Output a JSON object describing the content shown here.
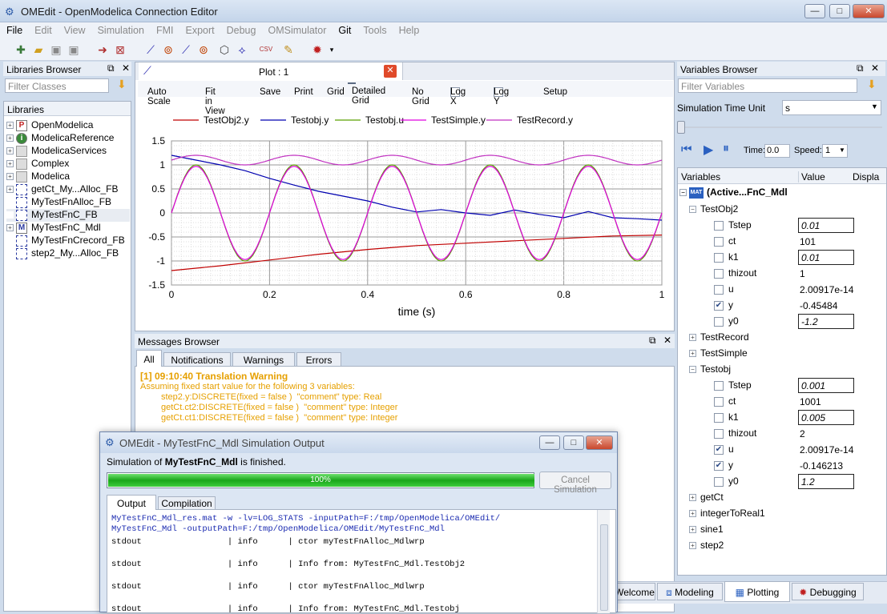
{
  "window": {
    "title": "OMEdit - OpenModelica Connection Editor",
    "min_label": "—",
    "max_label": "□",
    "close_label": "✕"
  },
  "menu": [
    {
      "label": "File",
      "on": true
    },
    {
      "label": "Edit"
    },
    {
      "label": "View"
    },
    {
      "label": "Simulation"
    },
    {
      "label": "FMI"
    },
    {
      "label": "Export"
    },
    {
      "label": "Debug"
    },
    {
      "label": "OMSimulator"
    },
    {
      "label": "Git",
      "on": true
    },
    {
      "label": "Tools"
    },
    {
      "label": "Help"
    }
  ],
  "libraries_browser": {
    "title": "Libraries Browser",
    "filter_placeholder": "Filter Classes",
    "header": "Libraries",
    "items": [
      {
        "label": "OpenModelica",
        "icon": "P"
      },
      {
        "label": "ModelicaReference",
        "icon": "i"
      },
      {
        "label": "ModelicaServices",
        "icon": ""
      },
      {
        "label": "Complex",
        "icon": ""
      },
      {
        "label": "Modelica",
        "icon": ""
      },
      {
        "label": "getCt_My...Alloc_FB",
        "icon": ""
      },
      {
        "label": "MyTestFnAlloc_FB",
        "icon": ""
      },
      {
        "label": "MyTestFnC_FB",
        "icon": ""
      },
      {
        "label": "MyTestFnC_Mdl",
        "icon": "M"
      },
      {
        "label": "MyTestFnCrecord_FB",
        "icon": ""
      },
      {
        "label": "step2_My...Alloc_FB",
        "icon": ""
      }
    ]
  },
  "plot": {
    "tab_title": "Plot : 1",
    "tools": [
      "Auto Scale",
      "Fit in View",
      "Save",
      "Print",
      "Grid",
      "Detailed Grid",
      "No Grid",
      "Log X",
      "Log Y",
      "Setup"
    ]
  },
  "chart_data": {
    "type": "line",
    "xlabel": "time (s)",
    "ylabel": "",
    "xlim": [
      0,
      1
    ],
    "ylim": [
      -1.5,
      1.5
    ],
    "xticks": [
      "0",
      "0.2",
      "0.4",
      "0.6",
      "0.8",
      "1"
    ],
    "yticks": [
      "1.5",
      "1",
      "0.5",
      "0",
      "-0.5",
      "-1",
      "-1.5"
    ],
    "grid": "detailed",
    "legend": "top",
    "series": [
      {
        "name": "TestObj2.y",
        "color": "#c00000",
        "x": [
          0,
          0.1,
          0.2,
          0.3,
          0.4,
          0.5,
          0.6,
          0.7,
          0.8,
          0.9,
          1.0
        ],
        "y": [
          -1.2,
          -1.1,
          -0.98,
          -0.86,
          -0.76,
          -0.68,
          -0.63,
          -0.58,
          -0.53,
          -0.48,
          -0.46
        ]
      },
      {
        "name": "Testobj.y",
        "color": "#0000b0",
        "x": [
          0,
          0.05,
          0.1,
          0.15,
          0.2,
          0.25,
          0.3,
          0.35,
          0.4,
          0.45,
          0.5,
          0.55,
          0.6,
          0.65,
          0.7,
          0.75,
          0.8,
          0.85,
          0.9,
          0.95,
          1.0
        ],
        "y": [
          1.2,
          1.1,
          1.0,
          0.88,
          0.72,
          0.58,
          0.45,
          0.35,
          0.25,
          0.12,
          0.02,
          0.07,
          0.0,
          -0.05,
          0.06,
          -0.03,
          -0.1,
          0.03,
          -0.1,
          -0.12,
          -0.15
        ]
      },
      {
        "name": "Testobj.u",
        "color": "#5aa000",
        "x": [
          0,
          0.05,
          0.1,
          0.15,
          0.2,
          0.25,
          0.3,
          0.35,
          0.4,
          0.45,
          0.5,
          0.55,
          0.6,
          0.65,
          0.7,
          0.75,
          0.8,
          0.85,
          0.9,
          0.95,
          1.0
        ],
        "y": [
          0,
          1,
          0,
          -1,
          0,
          1,
          0,
          -1,
          0,
          1,
          0,
          -1,
          0,
          1,
          0,
          -1,
          0,
          1,
          0,
          -1,
          0
        ]
      },
      {
        "name": "TestSimple.y",
        "color": "#e000e0",
        "x": [
          0,
          0.05,
          0.1,
          0.15,
          0.2,
          0.25,
          0.3,
          0.35,
          0.4,
          0.45,
          0.5,
          0.55,
          0.6,
          0.65,
          0.7,
          0.75,
          0.8,
          0.85,
          0.9,
          0.95,
          1.0
        ],
        "y": [
          0,
          0.95,
          0,
          -0.95,
          0,
          0.95,
          0,
          -0.95,
          0,
          0.95,
          0,
          -0.95,
          0,
          0.95,
          0,
          -0.95,
          0,
          0.95,
          0,
          -0.95,
          0
        ]
      },
      {
        "name": "TestRecord.y",
        "color": "#c030c0",
        "x": [
          0,
          0.05,
          0.1,
          0.15,
          0.2,
          0.25,
          0.3,
          0.35,
          0.4,
          0.45,
          0.5,
          0.55,
          0.6,
          0.65,
          0.7,
          0.75,
          0.8,
          0.85,
          0.9,
          0.95,
          1.0
        ],
        "y": [
          1.1,
          1.2,
          1.1,
          1.0,
          1.1,
          1.2,
          1.1,
          1.0,
          1.1,
          1.2,
          1.1,
          1.0,
          1.1,
          1.2,
          1.1,
          1.0,
          1.1,
          1.2,
          1.1,
          1.0,
          1.1
        ]
      }
    ]
  },
  "messages": {
    "title": "Messages Browser",
    "tabs": [
      "All",
      "Notifications",
      "Warnings",
      "Errors"
    ],
    "heading": "[1] 09:10:40 Translation Warning",
    "lines": [
      "Assuming fixed start value for the following 3 variables:",
      "step2.y:DISCRETE(fixed = false )  \"comment\" type: Real",
      "getCt.ct2:DISCRETE(fixed = false )  \"comment\" type: Integer",
      "getCt.ct1:DISCRETE(fixed = false )  \"comment\" type: Integer"
    ]
  },
  "variables_browser": {
    "title": "Variables Browser",
    "filter_placeholder": "Filter Variables",
    "time_unit_label": "Simulation Time Unit",
    "time_unit": "s",
    "time_label": "Time:",
    "time_value": "0.0",
    "speed_label": "Speed:",
    "speed_value": "1",
    "col_variables": "Variables",
    "col_value": "Value",
    "col_display": "Displa",
    "root": "(Active...FnC_Mdl",
    "rows": [
      {
        "label": "TestObj2",
        "type": "group",
        "indent": 1
      },
      {
        "label": "Tstep",
        "value": "0.01",
        "box": true,
        "indent": 2
      },
      {
        "label": "ct",
        "value": "101",
        "indent": 2
      },
      {
        "label": "k1",
        "value": "0.01",
        "box": true,
        "indent": 2
      },
      {
        "label": "thizout",
        "value": "1",
        "indent": 2
      },
      {
        "label": "u",
        "value": "2.00917e-14",
        "indent": 2
      },
      {
        "label": "y",
        "value": "-0.45484",
        "checked": true,
        "indent": 2
      },
      {
        "label": "y0",
        "value": "-1.2",
        "box": true,
        "indent": 2
      },
      {
        "label": "TestRecord",
        "type": "group",
        "collapsed": true,
        "indent": 1
      },
      {
        "label": "TestSimple",
        "type": "group",
        "collapsed": true,
        "indent": 1
      },
      {
        "label": "Testobj",
        "type": "group",
        "indent": 1
      },
      {
        "label": "Tstep",
        "value": "0.001",
        "box": true,
        "indent": 2
      },
      {
        "label": "ct",
        "value": "1001",
        "indent": 2
      },
      {
        "label": "k1",
        "value": "0.005",
        "box": true,
        "indent": 2
      },
      {
        "label": "thizout",
        "value": "2",
        "indent": 2
      },
      {
        "label": "u",
        "value": "2.00917e-14",
        "checked": true,
        "indent": 2
      },
      {
        "label": "y",
        "value": "-0.146213",
        "checked": true,
        "indent": 2
      },
      {
        "label": "y0",
        "value": "1.2",
        "box": true,
        "indent": 2
      },
      {
        "label": "getCt",
        "type": "group",
        "collapsed": true,
        "indent": 1
      },
      {
        "label": "integerToReal1",
        "type": "group",
        "collapsed": true,
        "indent": 1
      },
      {
        "label": "sine1",
        "type": "group",
        "collapsed": true,
        "indent": 1
      },
      {
        "label": "step2",
        "type": "group",
        "collapsed": true,
        "indent": 1
      }
    ]
  },
  "perspectives": {
    "welcome": "Welcome",
    "modeling": "Modeling",
    "plotting": "Plotting",
    "debugging": "Debugging"
  },
  "sim_output": {
    "title": "OMEdit - MyTestFnC_Mdl Simulation Output",
    "status_prefix": "Simulation of ",
    "status_model": "MyTestFnC_Mdl",
    "status_suffix": " is finished.",
    "progress_label": "100%",
    "progress": 1.0,
    "cancel_label": "Cancel Simulation",
    "tabs": [
      "Output",
      "Compilation"
    ],
    "cmd": [
      "MyTestFnC_Mdl_res.mat -w -lv=LOG_STATS -inputPath=F:/tmp/OpenModelica/OMEdit/",
      "MyTestFnC_Mdl -outputPath=F:/tmp/OpenModelica/OMEdit/MyTestFnC_Mdl"
    ],
    "log": [
      "stdout                 | info      | ctor myTestFnAlloc_Mdlwrp",
      "stdout                 | info      | Info from: MyTestFnC_Mdl.TestObj2",
      "stdout                 | info      | ctor myTestFnAlloc_Mdlwrp",
      "stdout                 | info      | Info from: MyTestFnC_Mdl.Testobj"
    ]
  }
}
